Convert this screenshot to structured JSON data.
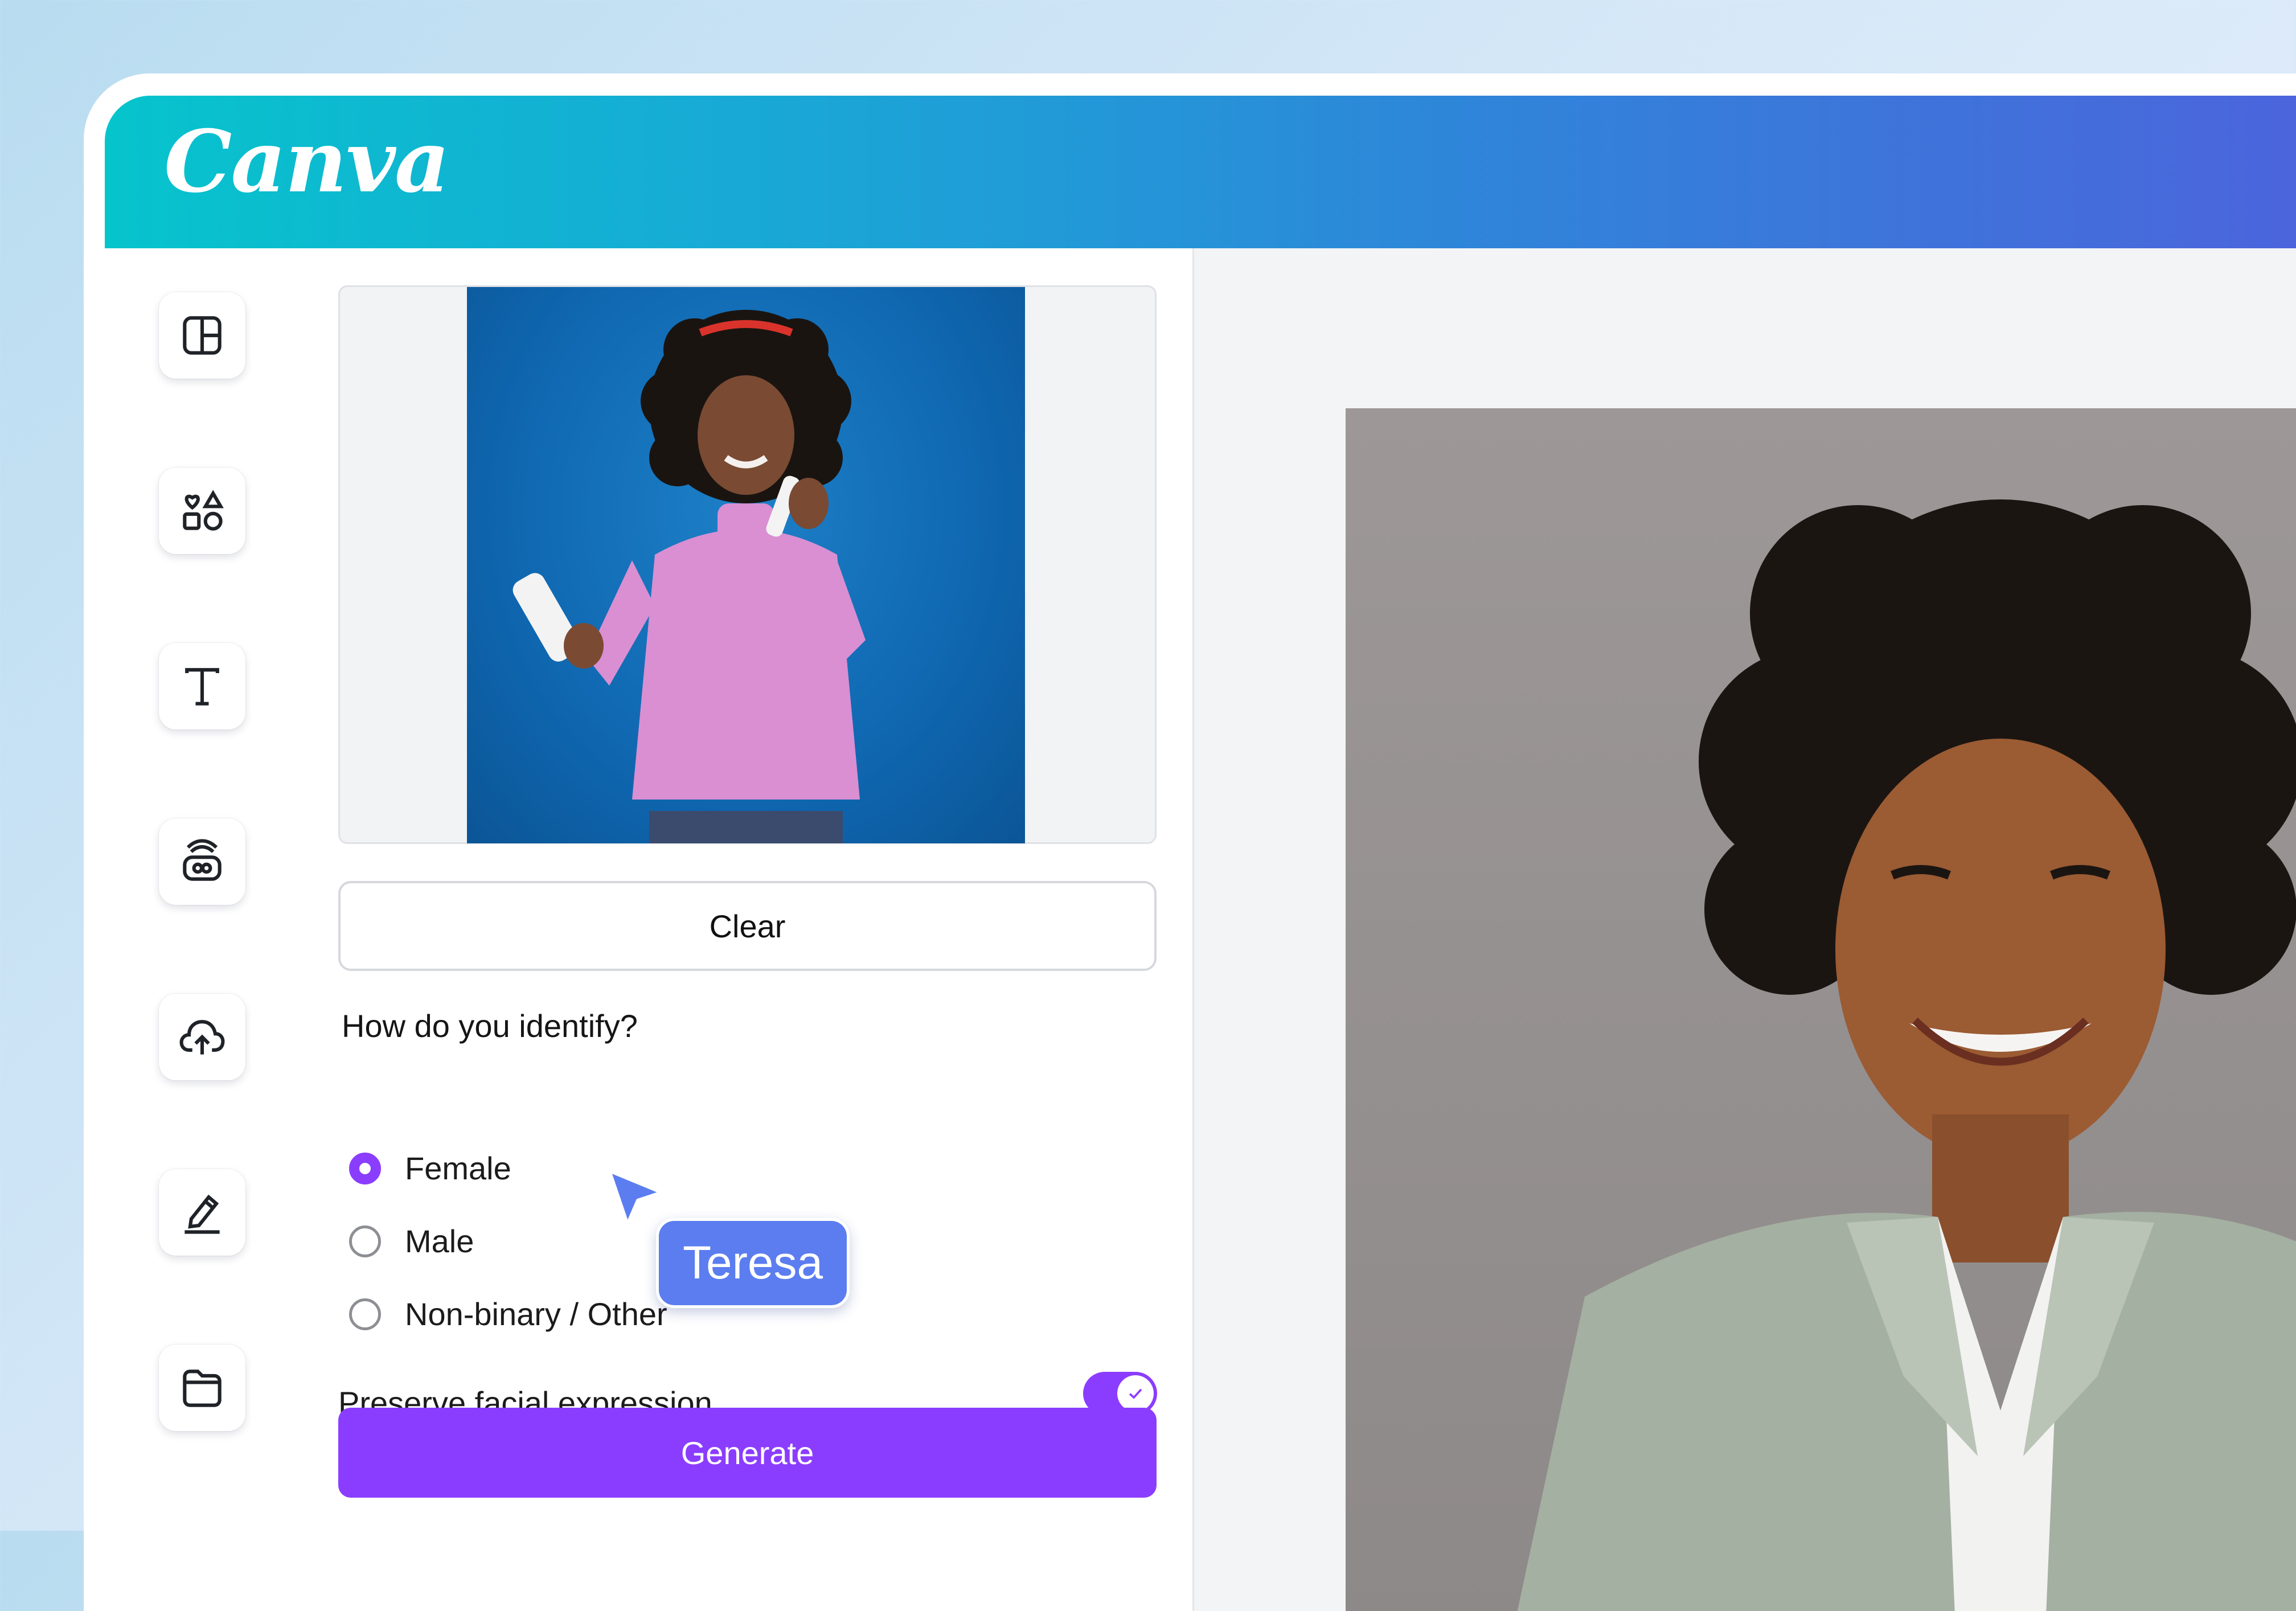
{
  "app": {
    "logo_text": "Canva"
  },
  "colors": {
    "accent": "#8b3dff",
    "header_start": "#06c4cc",
    "header_end": "#4d63dc",
    "cursor": "#5b7df0"
  },
  "sidebar": {
    "items": [
      {
        "icon": "layout-icon"
      },
      {
        "icon": "elements-icon"
      },
      {
        "icon": "text-icon"
      },
      {
        "icon": "brand-icon"
      },
      {
        "icon": "upload-icon"
      },
      {
        "icon": "draw-icon"
      },
      {
        "icon": "folder-icon"
      }
    ]
  },
  "panel": {
    "clear_label": "Clear",
    "question": "How do you identify?",
    "options": [
      {
        "label": "Female",
        "selected": true
      },
      {
        "label": "Male",
        "selected": false
      },
      {
        "label": "Non-binary / Other",
        "selected": false
      }
    ],
    "preserve_label": "Preserve facial expression",
    "preserve_on": true,
    "generate_label": "Generate"
  },
  "collaborator": {
    "name": "Teresa"
  }
}
